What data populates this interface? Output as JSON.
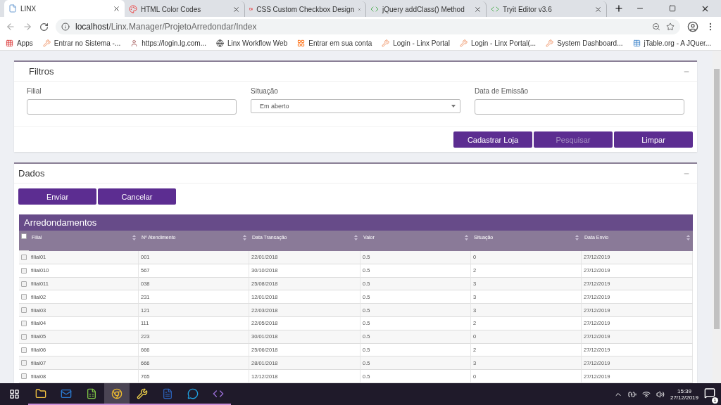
{
  "browser": {
    "tabs": [
      {
        "title": "LINX",
        "selected": true
      },
      {
        "title": "HTML Color Codes",
        "selected": false
      },
      {
        "title": "CSS Custom Checkbox Design",
        "selected": false
      },
      {
        "title": "jQuery addClass() Method",
        "selected": false
      },
      {
        "title": "Tryit Editor v3.6",
        "selected": false
      }
    ],
    "url_host": "localhost",
    "url_path": "/Linx.Manager/ProjetoArredondar/Index",
    "bookmarks": [
      "Apps",
      "Entrar no Sistema -...",
      "https://login.lg.com...",
      "Linx Workflow Web",
      "Entrar em sua conta",
      "Login - Linx Portal",
      "Login - Linx Portal(...",
      "System Dashboard...",
      "jTable.org - A JQuer..."
    ]
  },
  "filters": {
    "title": "Filtros",
    "fields": [
      {
        "label": "Filial",
        "kind": "text"
      },
      {
        "label": "Situação",
        "kind": "select",
        "value": "Em aberto"
      },
      {
        "label": "Data de Emissão",
        "kind": "text"
      }
    ],
    "buttons": [
      {
        "label": "Cadastrar Loja",
        "disabled": false
      },
      {
        "label": "Pesquisar",
        "disabled": true
      },
      {
        "label": "Limpar",
        "disabled": false
      }
    ]
  },
  "data": {
    "title": "Dados",
    "buttons": [
      "Enviar",
      "Cancelar"
    ],
    "table": {
      "title": "Arredondamentos",
      "select_all_checked": false,
      "columns": [
        "Filial",
        "Nº Atendimento",
        "Data Transação",
        "Valor",
        "Situação",
        "Data Envio"
      ],
      "rows": [
        {
          "cells": [
            "filial01",
            "001",
            "22/01/2018",
            "0.5",
            "0",
            "27/12/2019"
          ],
          "checked": false
        },
        {
          "cells": [
            "filial010",
            "567",
            "30/10/2018",
            "0.5",
            "2",
            "27/12/2019"
          ],
          "checked": false
        },
        {
          "cells": [
            "filial011",
            "038",
            "25/08/2018",
            "0.5",
            "3",
            "27/12/2019"
          ],
          "checked": false
        },
        {
          "cells": [
            "filial02",
            "231",
            "12/01/2018",
            "0.5",
            "3",
            "27/12/2019"
          ],
          "checked": false
        },
        {
          "cells": [
            "filial03",
            "121",
            "22/03/2018",
            "0.5",
            "3",
            "27/12/2019"
          ],
          "checked": false
        },
        {
          "cells": [
            "filial04",
            "111",
            "22/05/2018",
            "0.5",
            "2",
            "27/12/2019"
          ],
          "checked": false
        },
        {
          "cells": [
            "filial05",
            "223",
            "30/01/2018",
            "0.5",
            "0",
            "27/12/2019"
          ],
          "checked": false
        },
        {
          "cells": [
            "filial06",
            "666",
            "25/06/2018",
            "0.5",
            "2",
            "27/12/2019"
          ],
          "checked": false
        },
        {
          "cells": [
            "filial07",
            "666",
            "28/01/2018",
            "0.5",
            "3",
            "27/12/2019"
          ],
          "checked": false
        },
        {
          "cells": [
            "filial08",
            "765",
            "12/12/2018",
            "0.5",
            "0",
            "27/12/2019"
          ],
          "checked": false
        }
      ]
    }
  },
  "taskbar": {
    "apps": [
      {
        "selected": false
      },
      {
        "selected": false
      },
      {
        "selected": false
      },
      {
        "selected": true
      },
      {
        "selected": false
      },
      {
        "selected": false
      },
      {
        "selected": false
      },
      {
        "selected": false
      }
    ],
    "time": "15:39",
    "date": "27/12/2019",
    "notifications": "1"
  }
}
